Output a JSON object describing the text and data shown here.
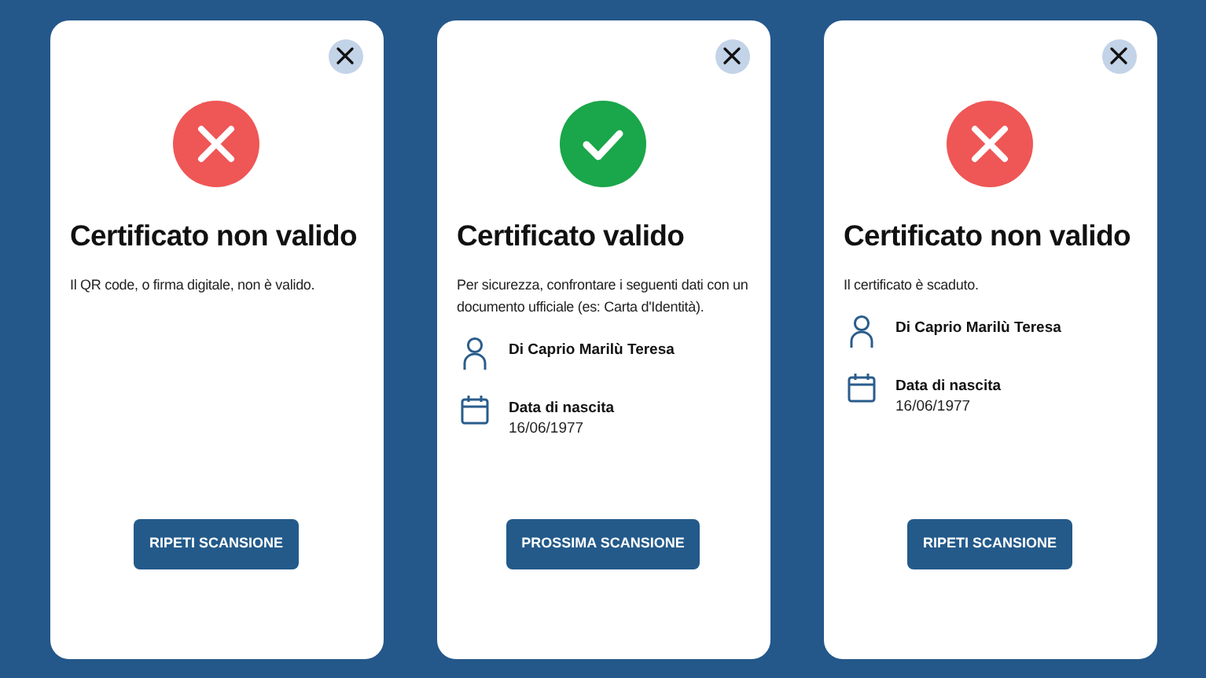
{
  "cards": [
    {
      "kind": "invalid",
      "title": "Certificato non valido",
      "message": "Il QR code, o firma digitale, non è valido.",
      "button": "RIPETI SCANSIONE"
    },
    {
      "kind": "valid",
      "title": "Certificato valido",
      "message": "Per sicurezza, confrontare i seguenti dati con un documento ufficiale (es: Carta d'Identità).",
      "details": [
        {
          "kind": "person",
          "label": "Di Caprio Marilù Teresa"
        },
        {
          "kind": "date",
          "label": "Data di nascita",
          "value": "16/06/1977"
        }
      ],
      "button": "PROSSIMA SCANSIONE"
    },
    {
      "kind": "invalid",
      "title": "Certificato non valido",
      "message": "Il certificato è scaduto.",
      "details": [
        {
          "kind": "person",
          "label": "Di Caprio Marilù Teresa"
        },
        {
          "kind": "date",
          "label": "Data di nascita",
          "value": "16/06/1977"
        }
      ],
      "button": "RIPETI SCANSIONE"
    }
  ]
}
